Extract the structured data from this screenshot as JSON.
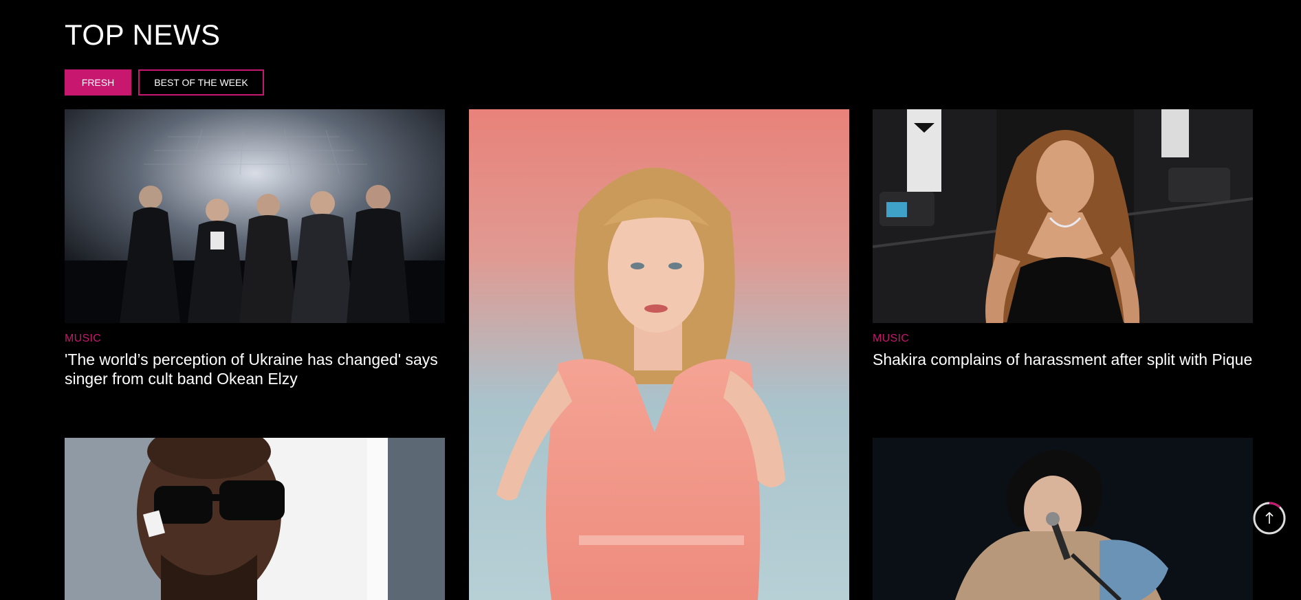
{
  "section": {
    "title": "TOP NEWS"
  },
  "tabs": [
    {
      "label": "FRESH",
      "active": true
    },
    {
      "label": "BEST OF THE WEEK",
      "active": false
    }
  ],
  "articles": [
    {
      "image": "band-photo",
      "category": "MUSIC",
      "headline": "'The world’s perception of Ukraine has changed' says singer from cult band Okean Elzy"
    },
    {
      "image": "singer-in-pink-dress-photo"
    },
    {
      "image": "singer-red-carpet-photo",
      "category": "MUSIC",
      "headline": "Shakira complains of harassment after split with Pique"
    },
    {
      "image": "man-in-sunglasses-photo"
    },
    {
      "image": "singer-with-guitar-photo"
    }
  ],
  "colors": {
    "accent": "#c8176f",
    "background": "#000000",
    "text": "#ffffff"
  },
  "scroll_to_top": {
    "icon": "arrow-up-icon",
    "progress": 0.12
  }
}
